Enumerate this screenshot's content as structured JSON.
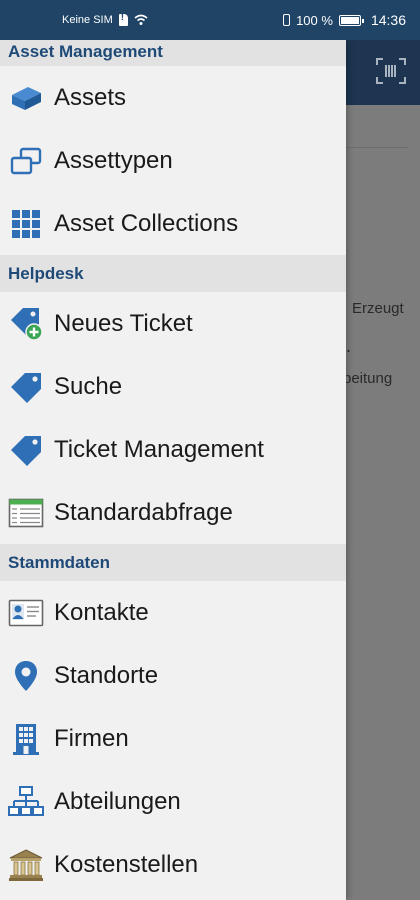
{
  "status_bar": {
    "carrier": "Keine SIM",
    "battery": "100 %",
    "time": "14:36"
  },
  "background": {
    "partial_text_1": "Erzeugt",
    "partial_text_2": ".",
    "partial_text_3": "rbeitung"
  },
  "drawer": {
    "sections": [
      {
        "title": "Asset Management",
        "items": [
          {
            "label": "Assets",
            "icon": "cube-icon"
          },
          {
            "label": "Assettypen",
            "icon": "stacked-windows-icon"
          },
          {
            "label": "Asset Collections",
            "icon": "grid-icon"
          }
        ]
      },
      {
        "title": "Helpdesk",
        "items": [
          {
            "label": "Neues Ticket",
            "icon": "tag-plus-icon"
          },
          {
            "label": "Suche",
            "icon": "tag-icon"
          },
          {
            "label": "Ticket Management",
            "icon": "tag-icon"
          },
          {
            "label": "Standardabfrage",
            "icon": "table-icon"
          }
        ]
      },
      {
        "title": "Stammdaten",
        "items": [
          {
            "label": "Kontakte",
            "icon": "contact-card-icon"
          },
          {
            "label": "Standorte",
            "icon": "location-pin-icon"
          },
          {
            "label": "Firmen",
            "icon": "building-icon"
          },
          {
            "label": "Abteilungen",
            "icon": "org-chart-icon"
          },
          {
            "label": "Kostenstellen",
            "icon": "bank-icon"
          }
        ]
      }
    ]
  },
  "colors": {
    "accent": "#1f4a78",
    "icon_blue": "#2f6fb5",
    "status_bar": "#1f4466",
    "drawer_bg": "#f1f1f1",
    "section_bg": "#e2e2e2"
  }
}
